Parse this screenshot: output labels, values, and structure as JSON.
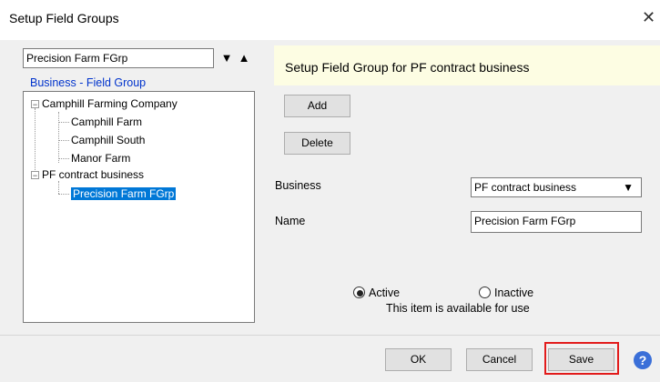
{
  "window": {
    "title": "Setup Field Groups"
  },
  "selector": {
    "value": "Precision Farm FGrp"
  },
  "tree": {
    "caption": "Business - Field Group",
    "nodes": [
      {
        "label": "Camphill Farming Company",
        "children": [
          "Camphill Farm",
          "Camphill South",
          "Manor Farm"
        ]
      },
      {
        "label": "PF contract business",
        "children": [
          "Precision Farm FGrp"
        ]
      }
    ]
  },
  "panel": {
    "title": "Setup Field Group for PF contract business",
    "add_label": "Add",
    "delete_label": "Delete",
    "business_label": "Business",
    "business_value": "PF contract business",
    "name_label": "Name",
    "name_value": "Precision Farm FGrp",
    "active_label": "Active",
    "inactive_label": "Inactive",
    "status_text": "This item is available for use",
    "active_selected": true
  },
  "footer": {
    "ok_label": "OK",
    "cancel_label": "Cancel",
    "save_label": "Save",
    "save_highlight_color": "#e21b1b"
  },
  "icons": {
    "help": "help-icon",
    "close": "close-icon"
  }
}
